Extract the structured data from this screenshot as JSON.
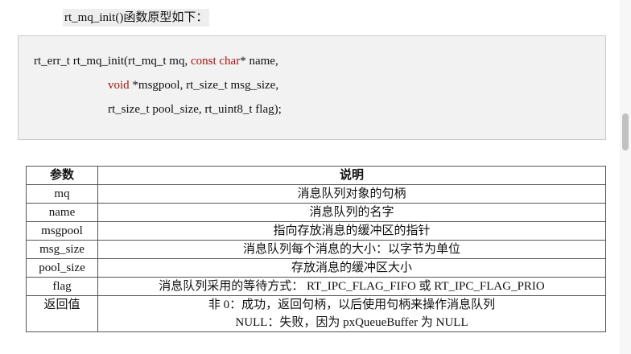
{
  "intro": "rt_mq_init()函数原型如下：",
  "code": {
    "line1_pre": "rt_err_t rt_mq_init(rt_mq_t mq, ",
    "line1_kw": "const char",
    "line1_post": "* name,",
    "line2_kw": "void",
    "line2_post": " *msgpool, rt_size_t msg_size,",
    "line3": "rt_size_t pool_size, rt_uint8_t flag);"
  },
  "table": {
    "headers": [
      "参数",
      "说明"
    ],
    "rows": [
      {
        "param": "mq",
        "desc": [
          "消息队列对象的句柄"
        ]
      },
      {
        "param": "name",
        "desc": [
          "消息队列的名字"
        ]
      },
      {
        "param": "msgpool",
        "desc": [
          "指向存放消息的缓冲区的指针"
        ]
      },
      {
        "param": "msg_size",
        "desc": [
          "消息队列每个消息的大小：以字节为单位"
        ]
      },
      {
        "param": "pool_size",
        "desc": [
          "存放消息的缓冲区大小"
        ]
      },
      {
        "param": "flag",
        "desc": [
          "消息队列采用的等待方式： RT_IPC_FLAG_FIFO 或 RT_IPC_FLAG_PRIO"
        ]
      },
      {
        "param": "返回值",
        "desc": [
          "非 0：成功，返回句柄，以后使用句柄来操作消息队列",
          "NULL：失败，因为 pxQueueBuffer 为 NULL"
        ]
      }
    ]
  }
}
